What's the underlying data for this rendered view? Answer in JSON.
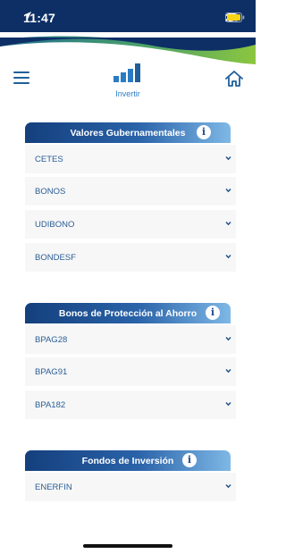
{
  "status_bar": {
    "time": "11:47"
  },
  "nav": {
    "invest_label": "Invertir"
  },
  "sections": [
    {
      "title": "Valores Gubernamentales",
      "items": [
        "CETES",
        "BONOS",
        "UDIBONO",
        "BONDESF"
      ]
    },
    {
      "title": "Bonos de Protección al Ahorro",
      "items": [
        "BPAG28",
        "BPAG91",
        "BPA182"
      ]
    },
    {
      "title": "Fondos de Inversión",
      "items": [
        "ENERFIN"
      ]
    }
  ],
  "info_glyph": "i",
  "colors": {
    "header_navy": "#0d2f66",
    "header_green": "#8cc63f",
    "accent_blue": "#2b7bc4",
    "row_text": "#2a5d96"
  },
  "icons": [
    "location-arrow-icon",
    "signal-icon",
    "wifi-icon",
    "battery-icon",
    "hamburger-menu-icon",
    "bar-chart-icon",
    "home-icon",
    "info-icon",
    "chevron-down-icon"
  ]
}
